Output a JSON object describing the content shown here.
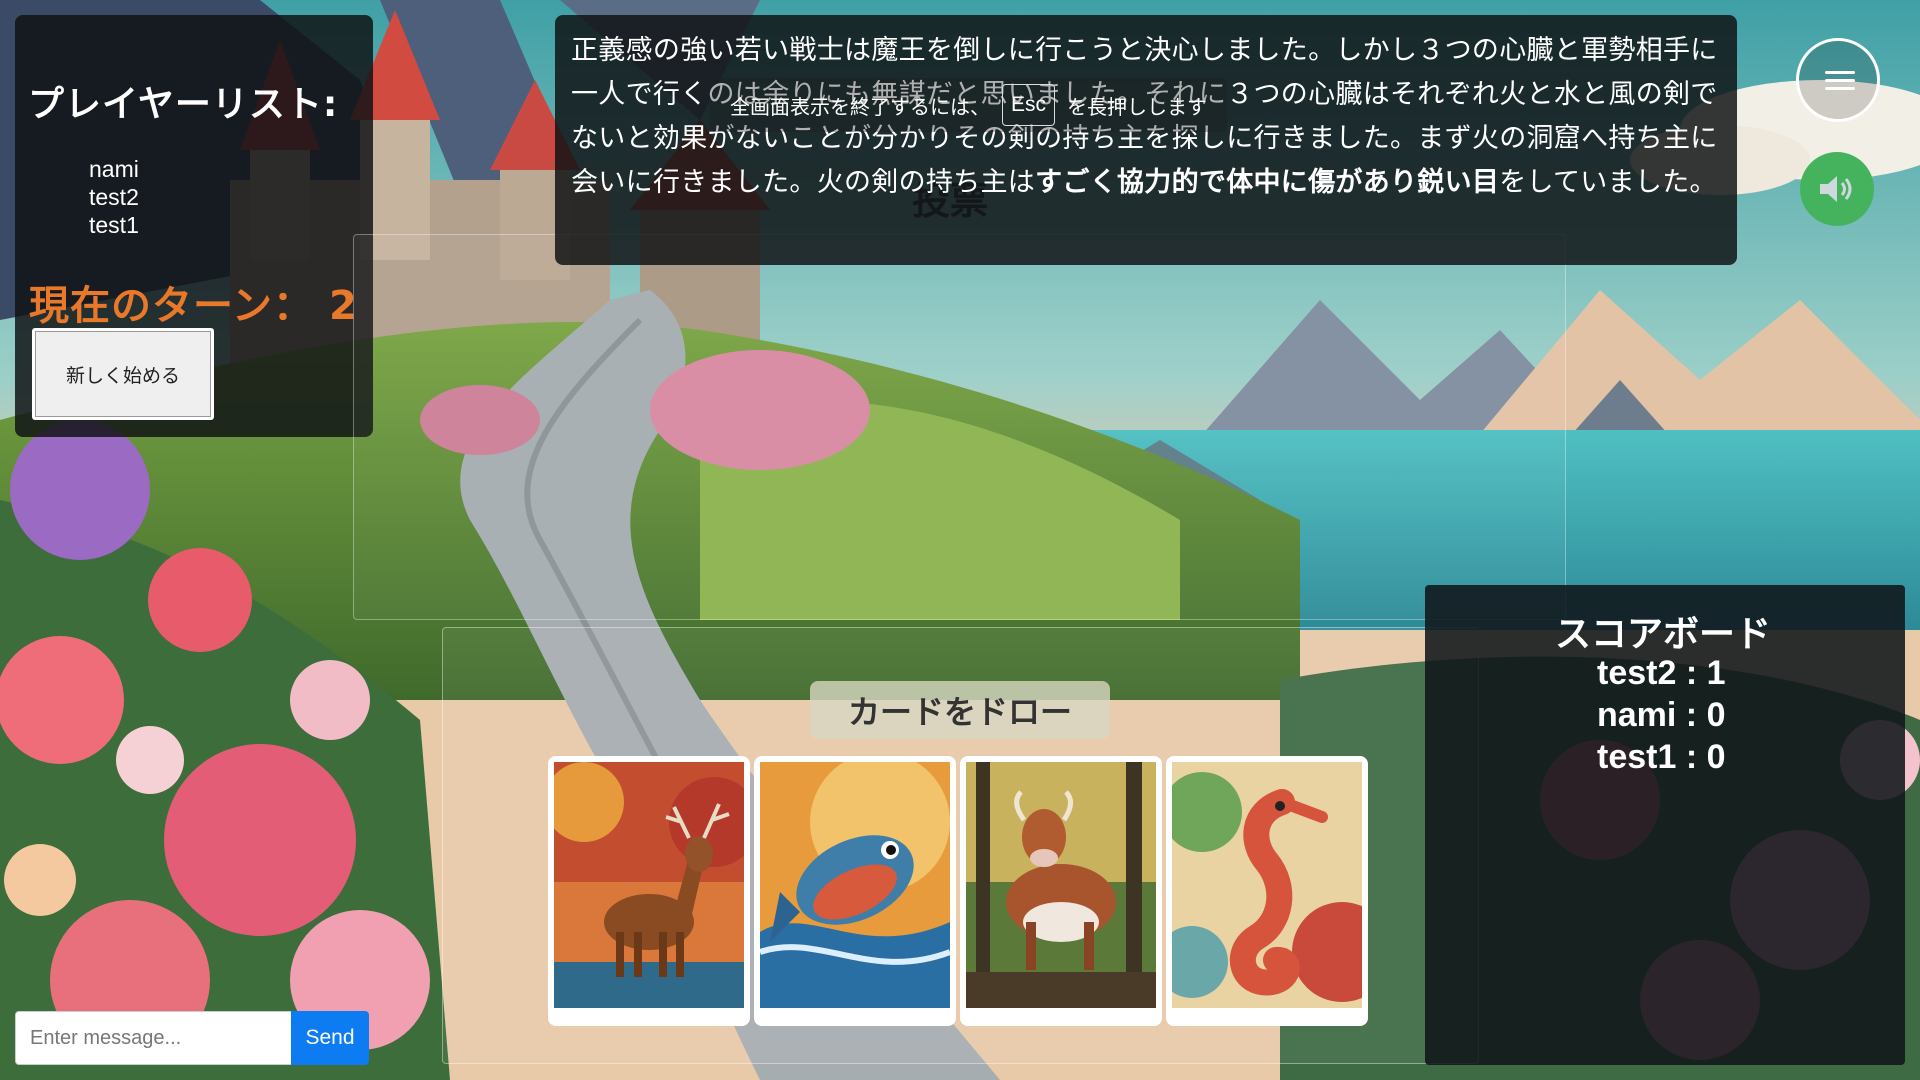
{
  "player_panel": {
    "title": "プレイヤーリスト:",
    "players": [
      "nami",
      "test2",
      "test1"
    ],
    "turn_label": "現在のターン：",
    "turn_number": "2",
    "new_game_label": "新しく始める"
  },
  "story": {
    "part1": "正義感の強い若い戦士は魔王を倒しに行こうと決心しました。しかし３つの心臓と軍勢相手に一人で行くのは余りにも無謀だと思いました。それに３つの心臓はそれぞれ火と水と風の剣でないと効果がないことが分かりその剣の持ち主を探しに行きました。まず火の洞窟へ持ち主に会いに行きました。火の剣の持ち主は",
    "bold": "すごく協力的で体中に傷があり鋭い目",
    "part2": "をしていました。"
  },
  "fullscreen_hint": {
    "prefix": "全画面表示を終了するには、",
    "key": "Esc",
    "suffix": "を長押しします"
  },
  "vote": {
    "title": "投票"
  },
  "hand": {
    "draw_label": "カードをドロー",
    "cards": [
      "deer",
      "fish",
      "cow",
      "seahorse"
    ]
  },
  "scoreboard": {
    "title": "スコアボード",
    "entries": [
      "test2 : 1",
      "nami : 0",
      "test1 : 0"
    ]
  },
  "chat": {
    "placeholder": "Enter message...",
    "send_label": "Send"
  },
  "icons": {
    "menu": "hamburger-menu-icon",
    "sound": "speaker-icon"
  },
  "colors": {
    "turn": "#e8782a",
    "send": "#0d7cf2",
    "sound": "#45b35e"
  }
}
